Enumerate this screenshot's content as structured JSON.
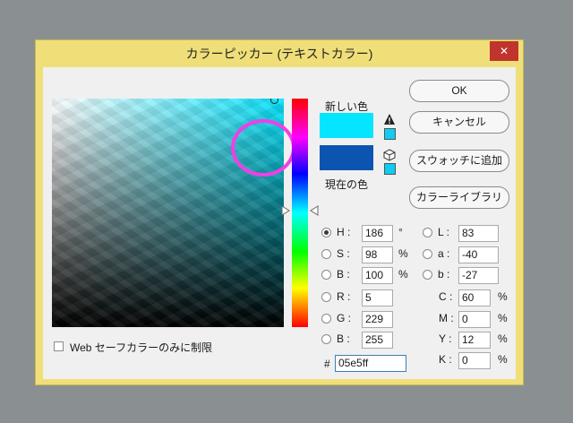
{
  "window": {
    "title": "カラーピッカー (テキストカラー)",
    "close_glyph": "✕"
  },
  "colors": {
    "new": "#05e5ff",
    "current": "#0b55b1",
    "highlight": "#f13ee6"
  },
  "preview": {
    "new_label": "新しい色",
    "current_label": "現在の色"
  },
  "icons": {
    "warning": "warning-icon",
    "cube": "cube-icon"
  },
  "buttons": {
    "ok": "OK",
    "cancel": "キャンセル",
    "add_swatch": "スウォッチに追加",
    "libraries": "カラーライブラリ"
  },
  "hsb": {
    "h": {
      "label": "H :",
      "value": "186",
      "unit": "°"
    },
    "s": {
      "label": "S :",
      "value": "98",
      "unit": "%"
    },
    "b": {
      "label": "B :",
      "value": "100",
      "unit": "%"
    }
  },
  "rgb": {
    "r": {
      "label": "R :",
      "value": "5"
    },
    "g": {
      "label": "G :",
      "value": "229"
    },
    "b": {
      "label": "B :",
      "value": "255"
    }
  },
  "lab": {
    "l": {
      "label": "L :",
      "value": "83"
    },
    "a": {
      "label": "a :",
      "value": "-40"
    },
    "b": {
      "label": "b :",
      "value": "-27"
    }
  },
  "cmyk": {
    "c": {
      "label": "C :",
      "value": "60",
      "unit": "%"
    },
    "m": {
      "label": "M :",
      "value": "0",
      "unit": "%"
    },
    "y": {
      "label": "Y :",
      "value": "12",
      "unit": "%"
    },
    "k": {
      "label": "K :",
      "value": "0",
      "unit": "%"
    }
  },
  "hex": {
    "label": "#",
    "value": "05e5ff"
  },
  "web_safe": {
    "label": "Web セーフカラーのみに制限",
    "checked": false
  }
}
